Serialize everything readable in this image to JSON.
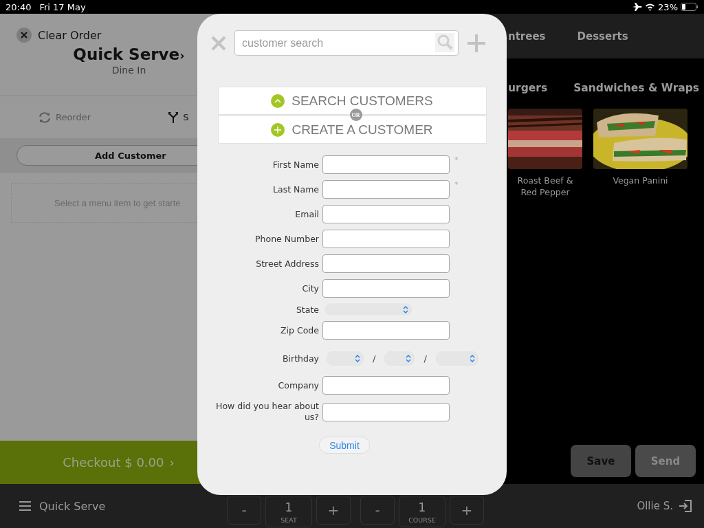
{
  "status_bar": {
    "time": "20:40",
    "date": "Fri 17 May",
    "battery": "23%"
  },
  "order_panel": {
    "clear_button": "Clear Order",
    "title": "Quick Serve",
    "title_chevron": "›",
    "order_type": "Dine In",
    "actions": [
      {
        "label": "Reorder",
        "kind": "reorder"
      },
      {
        "label": "S",
        "kind": "split"
      }
    ],
    "add_customer": "Add Customer",
    "empty_hint": "Select a menu item to get starte",
    "checkout": "Checkout $ 0.00",
    "checkout_chevron": "›"
  },
  "menu": {
    "categories": [
      "ntrees",
      "Desserts"
    ],
    "subcategories": [
      "urgers",
      "Sandwiches & Wraps"
    ],
    "items": [
      {
        "name": "Roast Beef & Red Pepper",
        "kind": "picture"
      },
      {
        "name": "Vegan Panini",
        "kind": "picture"
      }
    ],
    "buttons": [
      "Save",
      "Send"
    ]
  },
  "modal": {
    "search": {
      "placeholder": "customer search"
    },
    "options": [
      {
        "label": "SEARCH CUSTOMERS",
        "kind": "search"
      },
      {
        "label": "CREATE A CUSTOMER",
        "kind": "create"
      }
    ],
    "separator": "OR",
    "fields": [
      {
        "label": "First Name",
        "kind": "text",
        "required_mark": "*"
      },
      {
        "label": "Last Name",
        "kind": "text",
        "required_mark": "*"
      },
      {
        "label": "Email",
        "kind": "text"
      },
      {
        "label": "Phone Number",
        "kind": "text"
      },
      {
        "label": "Street Address",
        "kind": "text"
      },
      {
        "label": "City",
        "kind": "text"
      },
      {
        "label": "State",
        "kind": "select"
      },
      {
        "label": "Zip Code",
        "kind": "text"
      },
      {
        "label": "Birthday",
        "kind": "date",
        "separators": [
          "/",
          "/"
        ]
      },
      {
        "label": "Company",
        "kind": "text"
      },
      {
        "label": "How did you hear about us?",
        "kind": "text"
      }
    ],
    "submit": "Submit"
  },
  "bottom_bar": {
    "menu_label": "Quick Serve",
    "steppers": [
      {
        "minus": "-",
        "value": "1",
        "label": "SEAT",
        "plus": "+"
      },
      {
        "minus": "-",
        "value": "1",
        "label": "COURSE",
        "plus": "+"
      }
    ],
    "user": "Ollie S."
  }
}
